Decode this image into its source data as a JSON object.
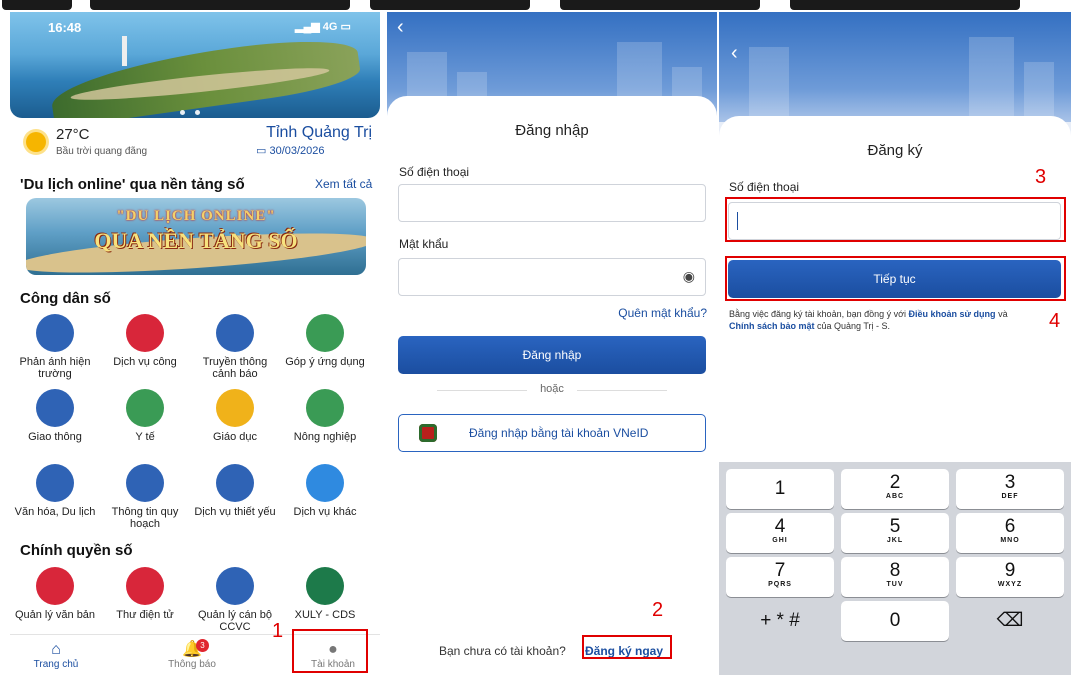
{
  "status": {
    "time": "16:48",
    "signal": "4G"
  },
  "home": {
    "weather": {
      "temp": "27°C",
      "desc": "Bầu trời quang đãng",
      "location": "Tỉnh Quảng Trị",
      "date": "30/03/2026"
    },
    "tourism": {
      "title": "'Du lịch online' qua nền tảng số",
      "see_all": "Xem tất cả",
      "banner_line1": "\"DU LỊCH ONLINE\"",
      "banner_line2": "QUA NỀN TẢNG SỐ"
    },
    "citizen": {
      "title": "Công dân số",
      "items": [
        {
          "label": "Phản ánh hiện trường",
          "color": "#2f63b5"
        },
        {
          "label": "Dịch vụ công",
          "color": "#d8263a"
        },
        {
          "label": "Truyền thông cảnh báo",
          "color": "#2f63b5"
        },
        {
          "label": "Góp ý ứng dụng",
          "color": "#3a9b55"
        },
        {
          "label": "Giao thông",
          "color": "#2f63b5"
        },
        {
          "label": "Y tế",
          "color": "#3a9b55"
        },
        {
          "label": "Giáo dục",
          "color": "#f0b21a"
        },
        {
          "label": "Nông nghiệp",
          "color": "#3a9b55"
        },
        {
          "label": "Văn hóa, Du lịch",
          "color": "#2f63b5"
        },
        {
          "label": "Thông tin quy hoạch",
          "color": "#2f63b5"
        },
        {
          "label": "Dịch vụ thiết yếu",
          "color": "#2f63b5"
        },
        {
          "label": "Dịch vụ khác",
          "color": "#2f8ae0"
        }
      ]
    },
    "government": {
      "title": "Chính quyền số",
      "items": [
        {
          "label": "Quản lý văn bản",
          "color": "#d8263a"
        },
        {
          "label": "Thư điện tử",
          "color": "#d8263a"
        },
        {
          "label": "Quản lý cán bộ CCVC",
          "color": "#2f63b5"
        },
        {
          "label": "XULY - CDS",
          "color": "#1d7a4a"
        }
      ]
    },
    "tabs": {
      "home": "Trang chủ",
      "notifications": "Thông báo",
      "account": "Tài khoản",
      "badge": "3"
    }
  },
  "login": {
    "title": "Đăng nhập",
    "phone_label": "Số điện thoại",
    "password_label": "Mật khẩu",
    "forgot": "Quên mật khẩu?",
    "submit": "Đăng nhập",
    "or": "hoặc",
    "vneid": "Đăng nhập bằng tài khoản VNeID",
    "no_account": "Bạn chưa có tài khoản?",
    "register": "Đăng ký ngay"
  },
  "register": {
    "title": "Đăng ký",
    "phone_label": "Số điện thoại",
    "continue": "Tiếp tục",
    "terms_pre": "Bằng việc đăng ký tài khoản, bạn đồng ý với ",
    "terms_link1": "Điều khoản sử dụng",
    "terms_mid": " và ",
    "terms_link2": "Chính sách bảo mật",
    "terms_post": " của Quảng Trị - S."
  },
  "keypad": [
    {
      "n": "1",
      "l": ""
    },
    {
      "n": "2",
      "l": "ABC"
    },
    {
      "n": "3",
      "l": "DEF"
    },
    {
      "n": "4",
      "l": "GHI"
    },
    {
      "n": "5",
      "l": "JKL"
    },
    {
      "n": "6",
      "l": "MNO"
    },
    {
      "n": "7",
      "l": "PQRS"
    },
    {
      "n": "8",
      "l": "TUV"
    },
    {
      "n": "9",
      "l": "WXYZ"
    },
    {
      "n": "+ * #",
      "l": ""
    },
    {
      "n": "0",
      "l": ""
    },
    {
      "n": "⌫",
      "l": ""
    }
  ],
  "markers": {
    "m1": "1",
    "m2": "2",
    "m3": "3",
    "m4": "4"
  }
}
